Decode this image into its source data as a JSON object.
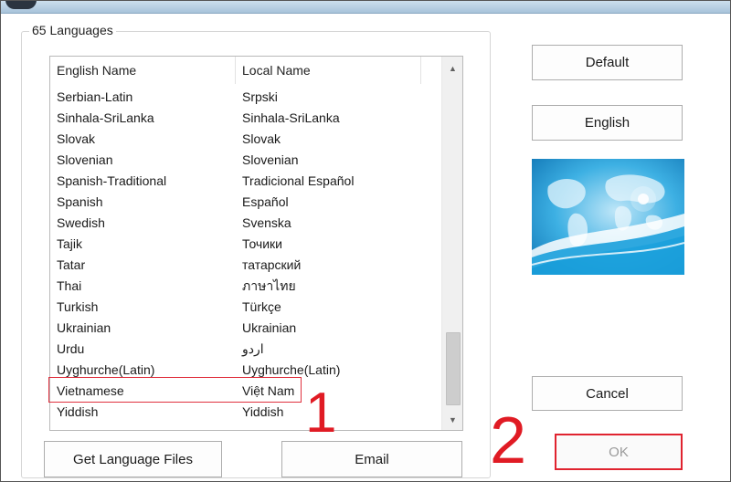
{
  "group": {
    "label": "65 Languages"
  },
  "list": {
    "columns": [
      "English Name",
      "Local Name"
    ],
    "rows": [
      {
        "english": "Serbian-Latin",
        "local": "Srpski"
      },
      {
        "english": "Sinhala-SriLanka",
        "local": "Sinhala-SriLanka"
      },
      {
        "english": "Slovak",
        "local": "Slovak"
      },
      {
        "english": "Slovenian",
        "local": "Slovenian"
      },
      {
        "english": "Spanish-Traditional",
        "local": "Tradicional Español"
      },
      {
        "english": "Spanish",
        "local": "Español"
      },
      {
        "english": "Swedish",
        "local": "Svenska"
      },
      {
        "english": "Tajik",
        "local": "Точики"
      },
      {
        "english": "Tatar",
        "local": "татарский"
      },
      {
        "english": "Thai",
        "local": "ภาษาไทย"
      },
      {
        "english": "Turkish",
        "local": "Türkçe"
      },
      {
        "english": "Ukrainian",
        "local": "Ukrainian"
      },
      {
        "english": "Urdu",
        "local": "اردو"
      },
      {
        "english": "Uyghurche(Latin)",
        "local": "Uyghurche(Latin)"
      },
      {
        "english": "Vietnamese",
        "local": "Việt Nam"
      },
      {
        "english": "Yiddish",
        "local": "Yiddish"
      }
    ],
    "highlighted_row": "Vietnamese"
  },
  "buttons": {
    "default": "Default",
    "english": "English",
    "cancel": "Cancel",
    "ok": "OK",
    "get_language_files": "Get Language Files",
    "email": "Email"
  },
  "annotations": {
    "step1": "1",
    "step2": "2"
  },
  "colors": {
    "annotation": "#e01b24",
    "banner_blue": "#1e9bd7"
  },
  "icons": {
    "scroll_up": "triangle-up-icon",
    "scroll_down": "triangle-down-icon"
  }
}
